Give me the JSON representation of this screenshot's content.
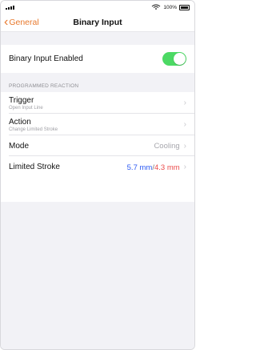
{
  "status": {
    "battery_text": "100%"
  },
  "nav": {
    "back_label": "General",
    "title": "Binary Input"
  },
  "toggle_row": {
    "label": "Binary Input Enabled",
    "enabled": true
  },
  "section": {
    "header": "PROGRAMMED REACTION"
  },
  "rows": {
    "trigger": {
      "label": "Trigger",
      "sub": "Open Input Line"
    },
    "action": {
      "label": "Action",
      "sub": "Change Limited Stroke"
    },
    "mode": {
      "label": "Mode",
      "value": "Cooling"
    },
    "limited_stroke": {
      "label": "Limited Stroke",
      "value_a": "5.7 mm",
      "separator": "/",
      "value_b": "4.3 mm"
    }
  },
  "colors": {
    "accent": "#e8792d",
    "toggle_on": "#4cd964",
    "value_blue": "#2b59f3",
    "value_red": "#ea4b4b"
  },
  "icons": [
    "signal-icon",
    "wifi-icon",
    "battery-icon",
    "chevron-left-icon",
    "chevron-right-icon"
  ]
}
